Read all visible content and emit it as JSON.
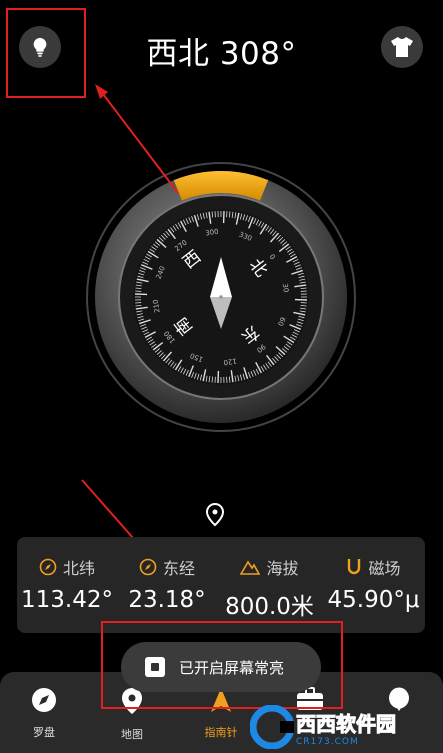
{
  "header": {
    "heading": "西北 308°"
  },
  "compass": {
    "heading_deg": 308,
    "letters": {
      "north": "北",
      "south": "南",
      "east": "东",
      "west": "西"
    },
    "accent_color": "#f0a020"
  },
  "stats": [
    {
      "label": "北纬",
      "value": "113.42°"
    },
    {
      "label": "东经",
      "value": "23.18°"
    },
    {
      "label": "海拔",
      "value": "800.0米"
    },
    {
      "label": "磁场",
      "value": "45.90°μ"
    }
  ],
  "toast": {
    "text": "已开启屏幕常亮"
  },
  "tabs": [
    {
      "label": "罗盘",
      "icon": "compass-icon"
    },
    {
      "label": "地图",
      "icon": "map-pin-icon"
    },
    {
      "label": "指南针",
      "icon": "north-arrow-icon",
      "active": true
    },
    {
      "label": "",
      "icon": "toolbox-icon"
    },
    {
      "label": "",
      "icon": "balloon-icon"
    }
  ],
  "watermark": {
    "text": "西西软件园",
    "sub": "CR173.COM"
  }
}
